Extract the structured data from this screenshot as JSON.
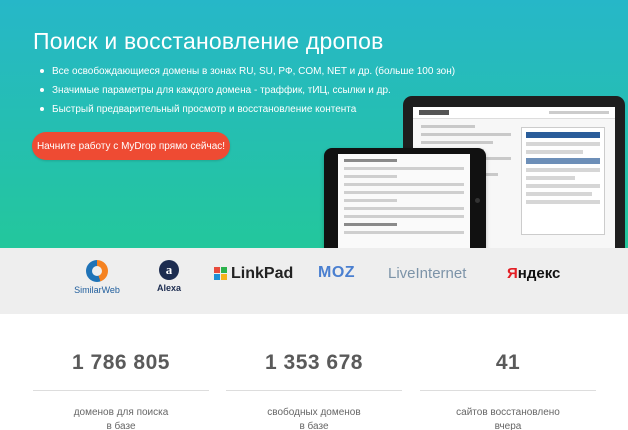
{
  "hero": {
    "title": "Поиск и восстановление дропов",
    "features": [
      "Все освобождающиеся домены в зонах RU, SU, РФ, COM, NET и др. (больше 100 зон)",
      "Значимые параметры для каждого домена - траффик, тИЦ, ссылки и др.",
      "Быстрый предварительный просмотр и восстановление контента"
    ],
    "cta_label": "Начните работу с MyDrop прямо сейчас!",
    "colors": {
      "gradient_top": "#26b7c8",
      "gradient_bottom": "#23c79c",
      "cta": "#ee4b33"
    }
  },
  "partners": {
    "similarweb": "SimilarWeb",
    "alexa_mark": "a",
    "alexa": "Alexa",
    "linkpad": "LinkPad",
    "moz": "MOZ",
    "liveinternet": "LiveInternet",
    "yandex_first": "Я",
    "yandex_rest": "ндекс"
  },
  "stats": [
    {
      "value": "1 786 805",
      "label_line1": "доменов для поиска",
      "label_line2": "в базе"
    },
    {
      "value": "1 353 678",
      "label_line1": "свободных доменов",
      "label_line2": "в базе"
    },
    {
      "value": "41",
      "label_line1": "сайтов восстановлено",
      "label_line2": "вчера"
    }
  ]
}
